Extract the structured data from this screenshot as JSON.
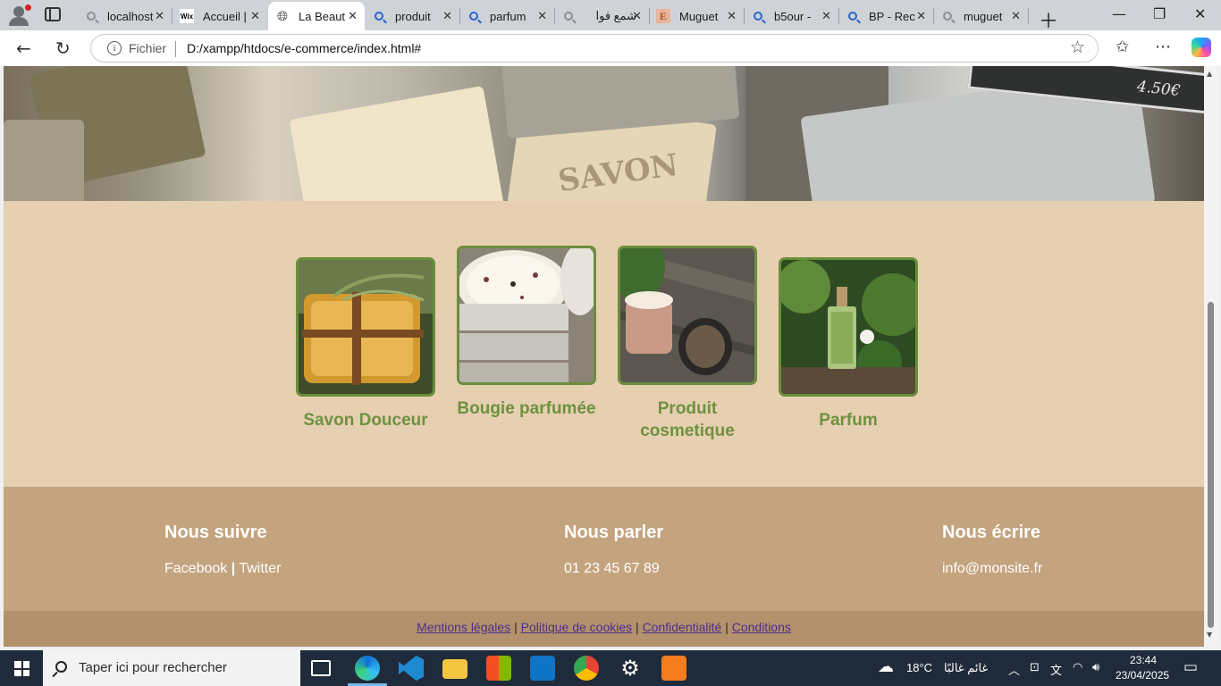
{
  "browser": {
    "tabs": [
      {
        "title": "localhost",
        "icon": "search-icon",
        "active": false
      },
      {
        "title": "Accueil |",
        "icon": "wix-icon",
        "active": false
      },
      {
        "title": "La Beaut",
        "icon": "globe-icon",
        "active": true
      },
      {
        "title": "produit",
        "icon": "search-icon",
        "active": false
      },
      {
        "title": "parfum",
        "icon": "search-icon",
        "active": false
      },
      {
        "title": "شمع فوا",
        "icon": "search-icon",
        "active": false
      },
      {
        "title": "Muguet",
        "icon": "etsy-icon",
        "active": false
      },
      {
        "title": "b5our -",
        "icon": "search-icon",
        "active": false
      },
      {
        "title": "BP - Rec",
        "icon": "search-icon",
        "active": false
      },
      {
        "title": "muguet",
        "icon": "search-icon",
        "active": false
      }
    ],
    "address": {
      "scheme": "Fichier",
      "url": "D:/xampp/htdocs/e-commerce/index.html#"
    }
  },
  "page": {
    "hero": {
      "price_tag": "4.50€",
      "stamp": "SAVON"
    },
    "products": [
      {
        "title": "Savon Douceur",
        "image": "soap-photo"
      },
      {
        "title": "Bougie parfumée",
        "image": "candle-photo"
      },
      {
        "title": "Produit cosmetique",
        "image": "cream-jar-photo"
      },
      {
        "title": "Parfum",
        "image": "perfume-bottle-photo"
      }
    ],
    "footer": {
      "follow": {
        "heading": "Nous suivre",
        "facebook": "Facebook",
        "separator": "|",
        "twitter": "Twitter"
      },
      "talk": {
        "heading": "Nous parler",
        "phone": "01 23 45 67 89"
      },
      "write": {
        "heading": "Nous écrire",
        "email": "info@monsite.fr"
      }
    },
    "legal": {
      "links": [
        "Mentions légales",
        "Politique de cookies",
        "Confidentialité",
        "Conditions"
      ],
      "separator": "|"
    },
    "colors": {
      "page_bg": "#e7cfb1",
      "accent_green": "#6e9240",
      "footer_bg": "#c4a47f",
      "legal_bg": "#b3916c"
    }
  },
  "taskbar": {
    "search_placeholder": "Taper ici pour rechercher",
    "weather": {
      "temp": "18°C",
      "condition": "غائم غالبًا"
    },
    "time": "23:44",
    "date": "23/04/2025"
  }
}
